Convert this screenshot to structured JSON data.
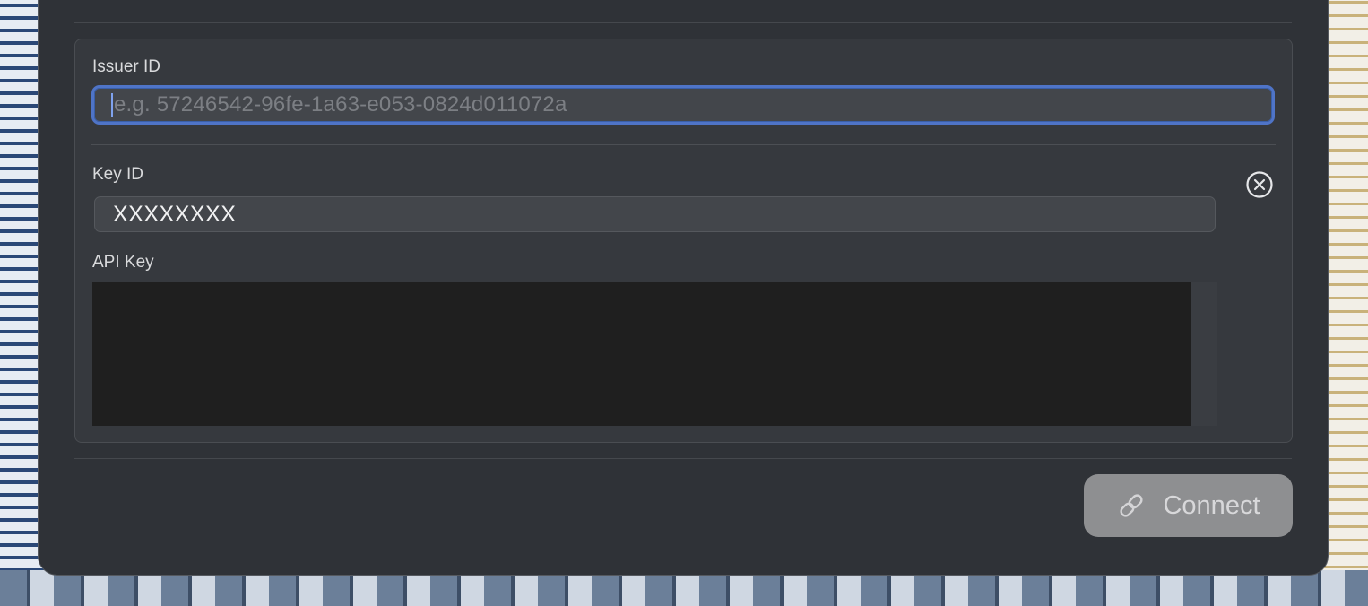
{
  "form": {
    "issuer_label": "Issuer ID",
    "issuer_placeholder": "e.g. 57246542-96fe-1a63-e053-0824d011072a",
    "key_label": "Key ID",
    "key_value": "XXXXXXXX",
    "api_label": "API Key",
    "clear_icon": "clear-circle-x-icon"
  },
  "footer": {
    "connect_label": "Connect",
    "connect_icon": "link-icon"
  },
  "colors": {
    "focus_ring": "#4f74c7",
    "window_bg": "#2f3237"
  }
}
